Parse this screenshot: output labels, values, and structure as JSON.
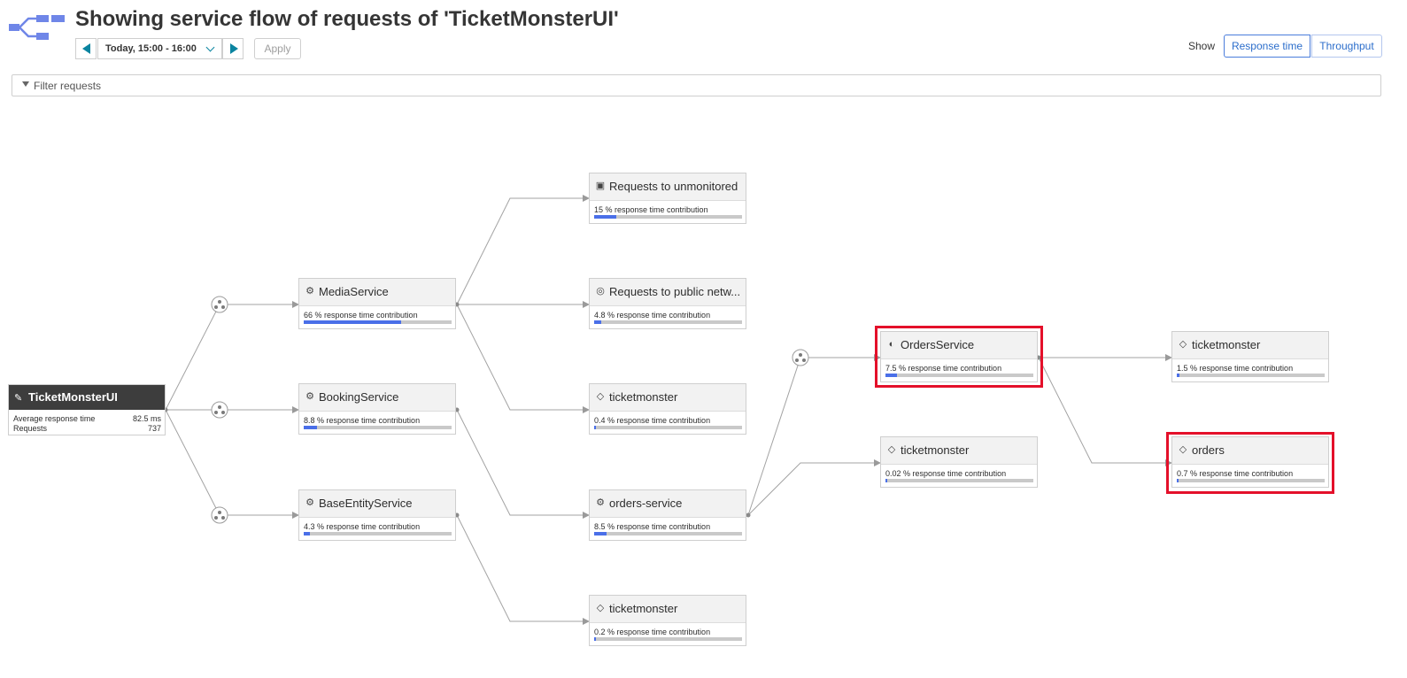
{
  "title": "Showing service flow of requests of 'TicketMonsterUI'",
  "timeframe": {
    "label": "Today, 15:00 - 16:00",
    "apply": "Apply"
  },
  "show": {
    "label": "Show",
    "response_time": "Response time",
    "throughput": "Throughput"
  },
  "filter": {
    "placeholder": "Filter requests"
  },
  "colors": {
    "accent": "#4a6fe8",
    "highlight": "#e4102a",
    "teal": "#0a84a0"
  },
  "root": {
    "name": "TicketMonsterUI",
    "avg_label": "Average response time",
    "avg_value": "82.5 ms",
    "req_label": "Requests",
    "req_value": "737"
  },
  "nodes": {
    "media": {
      "name": "MediaService",
      "contribution": "66 % response time contribution",
      "fill": 0.66,
      "icon": "service-icon"
    },
    "booking": {
      "name": "BookingService",
      "contribution": "8.8 % response time contribution",
      "fill": 0.088,
      "icon": "service-icon"
    },
    "baseentity": {
      "name": "BaseEntityService",
      "contribution": "4.3 % response time contribution",
      "fill": 0.043,
      "icon": "service-icon"
    },
    "unmonitored": {
      "name": "Requests to unmonitored ...",
      "contribution": "15 % response time contribution",
      "fill": 0.15,
      "icon": "server-icon"
    },
    "public": {
      "name": "Requests to public netw...",
      "contribution": "4.8 % response time contribution",
      "fill": 0.048,
      "icon": "globe-icon"
    },
    "tm1": {
      "name": "ticketmonster",
      "contribution": "0.4 % response time contribution",
      "fill": 0.004,
      "icon": "database-icon"
    },
    "orderssvc": {
      "name": "orders-service",
      "contribution": "8.5 % response time contribution",
      "fill": 0.085,
      "icon": "service-icon"
    },
    "tm2": {
      "name": "ticketmonster",
      "contribution": "0.2 % response time contribution",
      "fill": 0.002,
      "icon": "database-icon"
    },
    "ordersService": {
      "name": "OrdersService",
      "contribution": "7.5 % response time contribution",
      "fill": 0.075,
      "icon": "spring-icon"
    },
    "tm3": {
      "name": "ticketmonster",
      "contribution": "0.02 % response time contribution",
      "fill": 0.0002,
      "icon": "database-icon"
    },
    "tm4": {
      "name": "ticketmonster",
      "contribution": "1.5 % response time contribution",
      "fill": 0.015,
      "icon": "database-icon"
    },
    "orders": {
      "name": "orders",
      "contribution": "0.7 % response time contribution",
      "fill": 0.007,
      "icon": "database-icon"
    }
  }
}
